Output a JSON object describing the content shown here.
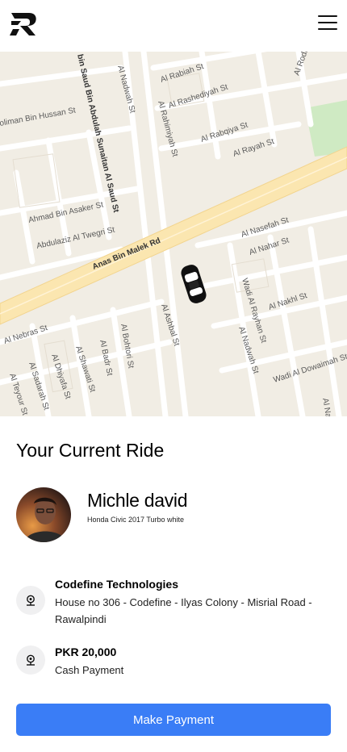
{
  "header": {
    "logo_icon": "r-logo-icon",
    "menu_icon": "hamburger-menu-icon"
  },
  "map": {
    "streets": {
      "s1": "bin Saud Bin Abdulah Sunaitan Al Saud St",
      "s2": "Al Nadwah St",
      "s3": "Al Rabiah St",
      "s4": "Al Rashediyah St",
      "s5": "Al Rahimiyah St",
      "s6": "Al Rabqiya St",
      "s7": "Al Rayah St",
      "s8": "Al Rodhaima St",
      "s9": "oliman Bin Hussan St",
      "s10": "Ahmad Bin Asaker St",
      "s11": "Abdulaziz Al Twegri St",
      "s12": "Anas Bin Malek Rd",
      "s13": "Al Nasefah St",
      "s14": "Al Nahar St",
      "s15": "Wadi Al Rayhan St",
      "s16": "Al Nakhl St",
      "s17": "Al Nebras St",
      "s18": "Al Ashbal St",
      "s19": "Al Bohtori St",
      "s20": "Al Nadwah St",
      "s21": "Wadi Al Dowaimah St",
      "s22": "Al Shawati St",
      "s23": "Al Dhiyafa St",
      "s24": "Al Sadarah St",
      "s25": "Al Teyour St",
      "s26": "Al Badr St",
      "s27": "Al Nar"
    },
    "car_icon": "car-marker-icon"
  },
  "ride": {
    "title": "Your Current Ride",
    "driver_name": "Michle david",
    "car": "Honda Civic 2017 Turbo white",
    "avatar_icon": "driver-avatar"
  },
  "destination": {
    "icon": "location-pin-icon",
    "title": "Codefine Technologies",
    "address": "House no 306 - Codefine - Ilyas Colony - Misrial Road - Rawalpindi"
  },
  "payment": {
    "icon": "location-pin-icon",
    "amount": "PKR 20,000",
    "method": "Cash Payment"
  },
  "actions": {
    "pay_label": "Make Payment"
  },
  "colors": {
    "accent": "#3a7df6",
    "map_bg": "#f1ede4",
    "road_major": "#fbe6b0",
    "park": "#cfeac3"
  }
}
